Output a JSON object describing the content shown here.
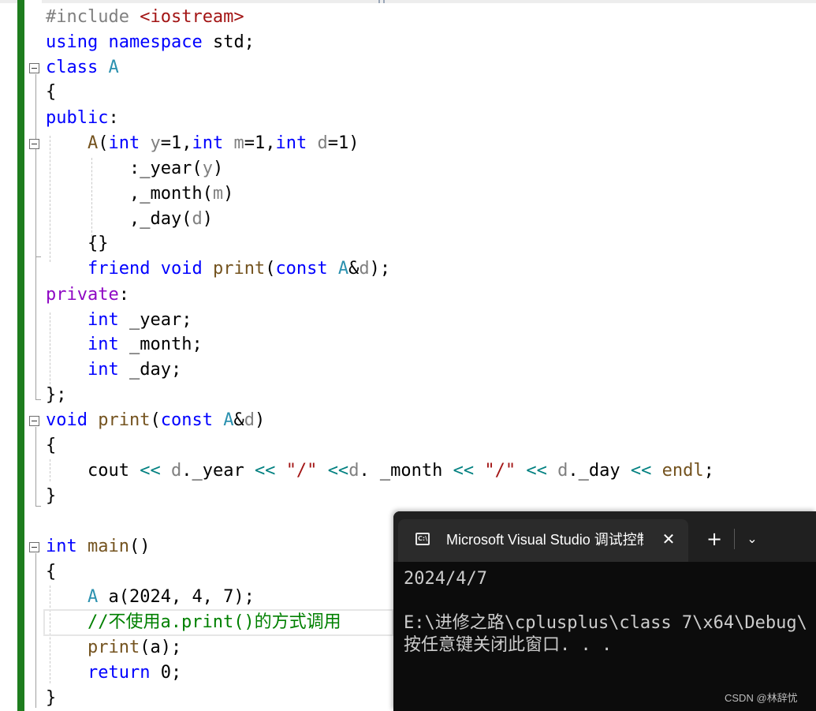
{
  "editor": {
    "lines": [
      [
        {
          "c": "pp",
          "t": "#include "
        },
        {
          "c": "st",
          "t": "<iostream>"
        }
      ],
      [
        {
          "c": "kw",
          "t": "using"
        },
        {
          "t": " "
        },
        {
          "c": "kw",
          "t": "namespace"
        },
        {
          "t": " std;"
        }
      ],
      [
        {
          "c": "kw",
          "t": "class"
        },
        {
          "t": " "
        },
        {
          "c": "ty",
          "t": "A"
        }
      ],
      [
        {
          "t": "{"
        }
      ],
      [
        {
          "c": "kw",
          "t": "public"
        },
        {
          "t": ":"
        }
      ],
      [
        {
          "t": "    "
        },
        {
          "c": "fn",
          "t": "A"
        },
        {
          "t": "("
        },
        {
          "c": "kw",
          "t": "int"
        },
        {
          "t": " "
        },
        {
          "c": "pa",
          "t": "y"
        },
        {
          "t": "=1,"
        },
        {
          "c": "kw",
          "t": "int"
        },
        {
          "t": " "
        },
        {
          "c": "pa",
          "t": "m"
        },
        {
          "t": "=1,"
        },
        {
          "c": "kw",
          "t": "int"
        },
        {
          "t": " "
        },
        {
          "c": "pa",
          "t": "d"
        },
        {
          "t": "=1)"
        }
      ],
      [
        {
          "t": "        :_year("
        },
        {
          "c": "pa",
          "t": "y"
        },
        {
          "t": ")"
        }
      ],
      [
        {
          "t": "        ,_month("
        },
        {
          "c": "pa",
          "t": "m"
        },
        {
          "t": ")"
        }
      ],
      [
        {
          "t": "        ,_day("
        },
        {
          "c": "pa",
          "t": "d"
        },
        {
          "t": ")"
        }
      ],
      [
        {
          "t": "    {}"
        }
      ],
      [
        {
          "t": "    "
        },
        {
          "c": "kw",
          "t": "friend"
        },
        {
          "t": " "
        },
        {
          "c": "kw",
          "t": "void"
        },
        {
          "t": " "
        },
        {
          "c": "fn",
          "t": "print"
        },
        {
          "t": "("
        },
        {
          "c": "kw",
          "t": "const"
        },
        {
          "t": " "
        },
        {
          "c": "ty",
          "t": "A"
        },
        {
          "t": "&"
        },
        {
          "c": "pa",
          "t": "d"
        },
        {
          "t": ");"
        }
      ],
      [
        {
          "c": "kw2",
          "t": "private"
        },
        {
          "t": ":"
        }
      ],
      [
        {
          "t": "    "
        },
        {
          "c": "kw",
          "t": "int"
        },
        {
          "t": " _year;"
        }
      ],
      [
        {
          "t": "    "
        },
        {
          "c": "kw",
          "t": "int"
        },
        {
          "t": " _month;"
        }
      ],
      [
        {
          "t": "    "
        },
        {
          "c": "kw",
          "t": "int"
        },
        {
          "t": " _day;"
        }
      ],
      [
        {
          "t": "};"
        }
      ],
      [
        {
          "c": "kw",
          "t": "void"
        },
        {
          "t": " "
        },
        {
          "c": "fn",
          "t": "print"
        },
        {
          "t": "("
        },
        {
          "c": "kw",
          "t": "const"
        },
        {
          "t": " "
        },
        {
          "c": "ty",
          "t": "A"
        },
        {
          "t": "&"
        },
        {
          "c": "pa",
          "t": "d"
        },
        {
          "t": ")"
        }
      ],
      [
        {
          "t": "{"
        }
      ],
      [
        {
          "t": "    cout "
        },
        {
          "c": "op",
          "t": "<<"
        },
        {
          "t": " "
        },
        {
          "c": "pa",
          "t": "d"
        },
        {
          "t": "._year "
        },
        {
          "c": "op",
          "t": "<<"
        },
        {
          "t": " "
        },
        {
          "c": "st",
          "t": "\"/\""
        },
        {
          "t": " "
        },
        {
          "c": "op",
          "t": "<<"
        },
        {
          "c": "pa",
          "t": "d"
        },
        {
          "t": ". _month "
        },
        {
          "c": "op",
          "t": "<<"
        },
        {
          "t": " "
        },
        {
          "c": "st",
          "t": "\"/\""
        },
        {
          "t": " "
        },
        {
          "c": "op",
          "t": "<<"
        },
        {
          "t": " "
        },
        {
          "c": "pa",
          "t": "d"
        },
        {
          "t": "._day "
        },
        {
          "c": "op",
          "t": "<<"
        },
        {
          "t": " "
        },
        {
          "c": "fn",
          "t": "endl"
        },
        {
          "t": ";"
        }
      ],
      [
        {
          "t": "}"
        }
      ],
      [],
      [
        {
          "c": "kw",
          "t": "int"
        },
        {
          "t": " "
        },
        {
          "c": "fn",
          "t": "main"
        },
        {
          "t": "()"
        }
      ],
      [
        {
          "t": "{"
        }
      ],
      [
        {
          "t": "    "
        },
        {
          "c": "ty",
          "t": "A"
        },
        {
          "t": " a(2024, 4, 7);"
        }
      ],
      [
        {
          "t": "    "
        },
        {
          "c": "cm",
          "t": "//不使用a.print()的方式调用"
        }
      ],
      [
        {
          "t": "    "
        },
        {
          "c": "fn",
          "t": "print"
        },
        {
          "t": "(a);"
        }
      ],
      [
        {
          "t": "    "
        },
        {
          "c": "kw",
          "t": "return"
        },
        {
          "t": " 0;"
        }
      ],
      [
        {
          "t": "}"
        }
      ]
    ]
  },
  "console": {
    "tab_title": "Microsoft Visual Studio 调试控制台",
    "tab_icon_text": "C:\\",
    "close_glyph": "✕",
    "new_tab_glyph": "+",
    "dropdown_glyph": "⌄",
    "output": [
      "2024/4/7",
      "",
      "E:\\进修之路\\cplusplus\\class 7\\x64\\Debug\\",
      "按任意键关闭此窗口. . ."
    ],
    "watermark": "CSDN @林辞忧"
  }
}
